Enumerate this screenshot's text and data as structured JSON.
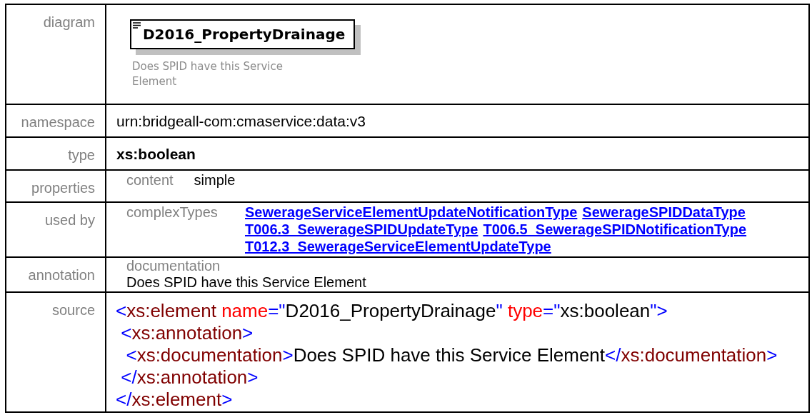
{
  "rows": [
    {
      "kind": "diagram",
      "label": "diagram",
      "element": "D2016_PropertyDrainage",
      "description": "Does SPID have this Service Element"
    },
    {
      "kind": "plain",
      "label": "namespace",
      "value": "urn:bridgeall-com:cmaservice:data:v3"
    },
    {
      "kind": "bold",
      "label": "type",
      "value": "xs:boolean"
    },
    {
      "kind": "props",
      "label": "properties",
      "key": "content",
      "value": "simple"
    },
    {
      "kind": "links",
      "label": "used by",
      "key": "complexTypes",
      "links": [
        "SewerageServiceElementUpdateNotificationType",
        "SewerageSPIDDataType",
        "T006.3_SewerageSPIDUpdateType",
        "T006.5_SewerageSPIDNotificationType",
        "T012.3_SewerageServiceElementUpdateType"
      ]
    },
    {
      "kind": "annotation",
      "label": "annotation",
      "key": "documentation",
      "value": "Does SPID have this Service Element"
    },
    {
      "kind": "source",
      "label": "source",
      "lines": [
        [
          {
            "kind": "bracket",
            "s": "<"
          },
          {
            "kind": "tag",
            "s": "xs:element"
          },
          {
            "kind": "attr",
            "s": " name"
          },
          {
            "kind": "bracket",
            "s": "=\""
          },
          {
            "kind": "text",
            "s": "D2016_PropertyDrainage"
          },
          {
            "kind": "bracket",
            "s": "\""
          },
          {
            "kind": "attr",
            "s": " type"
          },
          {
            "kind": "bracket",
            "s": "=\""
          },
          {
            "kind": "text",
            "s": "xs:boolean"
          },
          {
            "kind": "bracket",
            "s": "\">"
          }
        ],
        [
          {
            "kind": "bracket",
            "s": " <"
          },
          {
            "kind": "tag",
            "s": "xs:annotation"
          },
          {
            "kind": "bracket",
            "s": ">"
          }
        ],
        [
          {
            "kind": "bracket",
            "s": "  <"
          },
          {
            "kind": "tag",
            "s": "xs:documentation"
          },
          {
            "kind": "bracket",
            "s": ">"
          },
          {
            "kind": "text",
            "s": "Does SPID have this Service Element"
          },
          {
            "kind": "bracket",
            "s": "</"
          },
          {
            "kind": "tag",
            "s": "xs:documentation"
          },
          {
            "kind": "bracket",
            "s": ">"
          }
        ],
        [
          {
            "kind": "bracket",
            "s": " </"
          },
          {
            "kind": "tag",
            "s": "xs:annotation"
          },
          {
            "kind": "bracket",
            "s": ">"
          }
        ],
        [
          {
            "kind": "bracket",
            "s": "</"
          },
          {
            "kind": "tag",
            "s": "xs:element"
          },
          {
            "kind": "bracket",
            "s": ">"
          }
        ]
      ]
    }
  ]
}
